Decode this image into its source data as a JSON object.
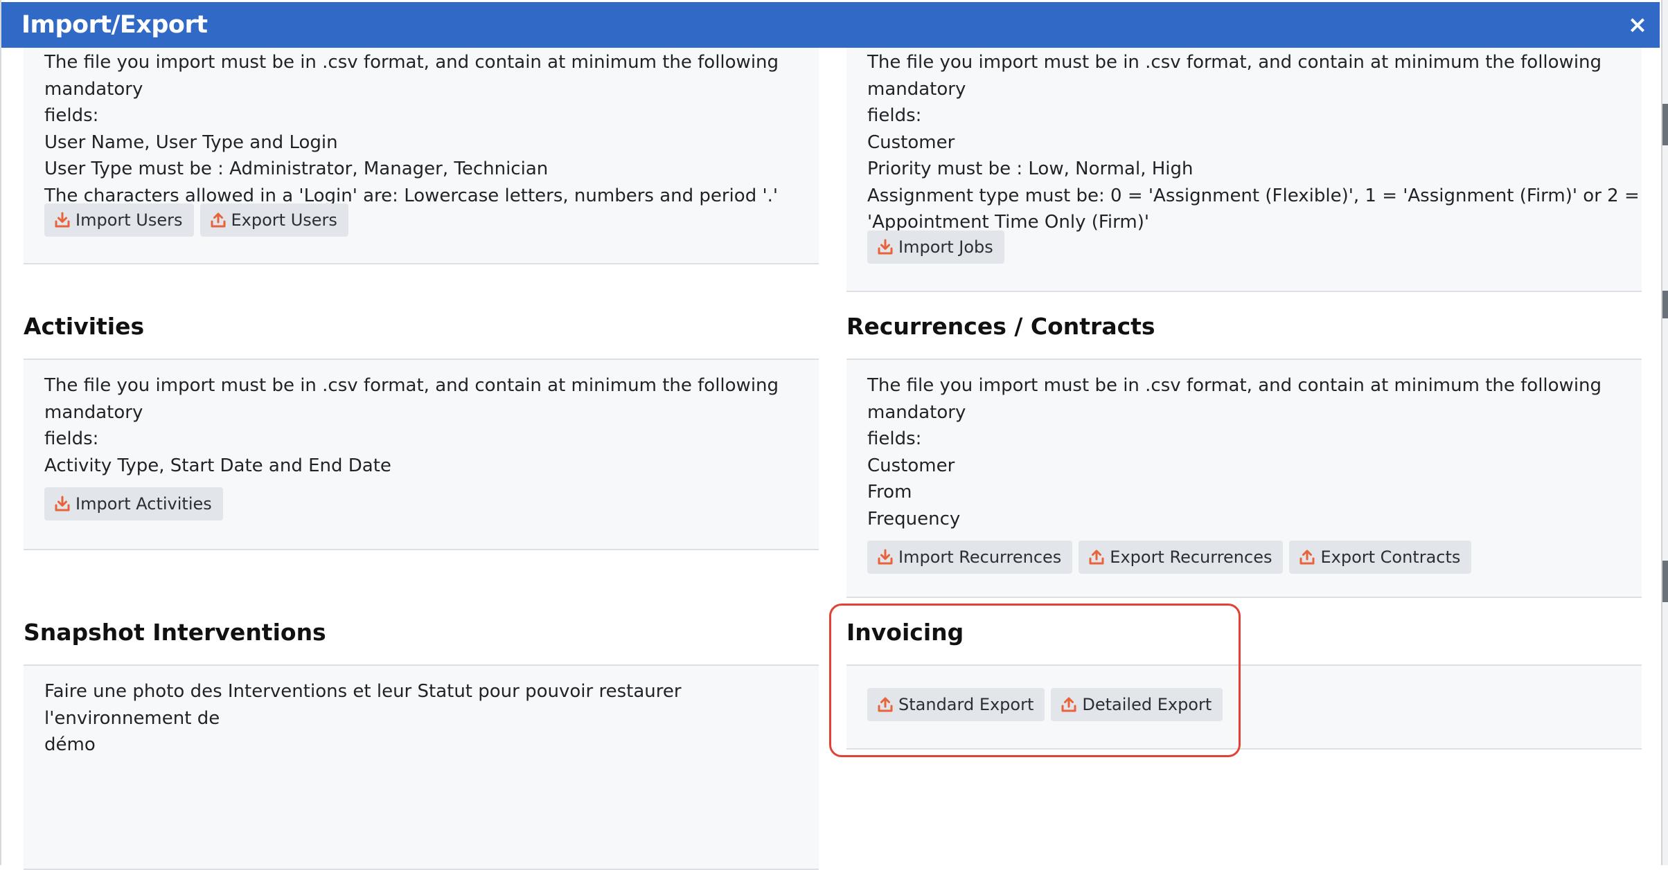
{
  "dialog": {
    "title": "Import/Export",
    "close_label": "×"
  },
  "users": {
    "lines": [
      "The file you import must be in .csv format, and contain at minimum the following mandatory",
      "fields:",
      "User Name, User Type and Login",
      "User Type must be : Administrator, Manager, Technician",
      "The characters allowed in a 'Login' are: Lowercase letters, numbers and period '.'"
    ],
    "buttons": {
      "import": "Import Users",
      "export": "Export Users"
    }
  },
  "jobs": {
    "lines": [
      "The file you import must be in .csv format, and contain at minimum the following mandatory",
      "fields:",
      "Customer",
      "Priority must be : Low, Normal, High",
      "Assignment type must be: 0 = 'Assignment (Flexible)', 1 = 'Assignment (Firm)' or 2 =",
      "'Appointment Time Only (Firm)'"
    ],
    "buttons": {
      "import": "Import Jobs"
    }
  },
  "activities": {
    "title": "Activities",
    "lines": [
      "The file you import must be in .csv format, and contain at minimum the following mandatory",
      "fields:",
      "Activity Type, Start Date and End Date"
    ],
    "buttons": {
      "import": "Import Activities"
    }
  },
  "recurrences": {
    "title": "Recurrences / Contracts",
    "lines": [
      "The file you import must be in .csv format, and contain at minimum the following mandatory",
      "fields:",
      "Customer",
      "From",
      "Frequency"
    ],
    "buttons": {
      "import": "Import Recurrences",
      "export_recurrences": "Export Recurrences",
      "export_contracts": "Export Contracts"
    }
  },
  "snapshot": {
    "title": "Snapshot Interventions",
    "lines": [
      "Faire une photo des Interventions et leur Statut pour pouvoir restaurer l'environnement de",
      "démo"
    ]
  },
  "invoicing": {
    "title": "Invoicing",
    "buttons": {
      "standard": "Standard Export",
      "detailed": "Detailed Export"
    }
  },
  "colors": {
    "titlebar": "#3169c6",
    "icon": "#e8623a",
    "highlight": "#e24236"
  }
}
